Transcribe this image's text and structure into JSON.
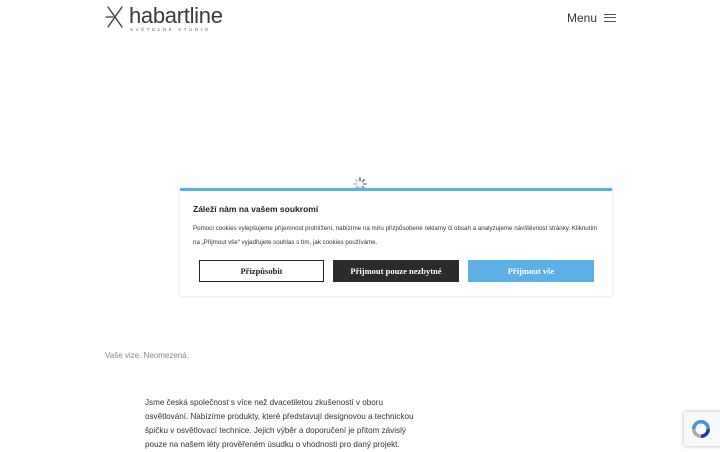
{
  "header": {
    "logo": {
      "name": "habartline",
      "tagline": "SVĚTELNÉ STUDIO"
    },
    "menu_label": "Menu"
  },
  "cookie_banner": {
    "title": "Záleží nám na vašem soukromí",
    "text": "Pomocí cookies vylepšujeme příjemnost prohlížení, nabízíme na míru přizpůsobené reklamy či obsah a analyzujeme návštěvnost stránky. Kliknutím na „Přijmout vše“ vyjadřujete souhlas s tím, jak cookies používáme.",
    "buttons": {
      "customize": "Přizpůsobit",
      "necessary_only": "Přijmout pouze nezbytné",
      "accept_all": "Přijmout vše"
    },
    "accent_color": "#5db0e5"
  },
  "main": {
    "tagline": "Vaše vize. Neomezená.",
    "about": "Jsme česká společnost s více než dvacetiletou zkušeností v oboru osvětlování. Nabízíme produkty, které představují designovou a technickou špičku v osvětlovací technice. Jejich výběr a doporučení je přitom závislý pouze na našem léty prověřeném úsudku o vhodnosti pro daný projekt."
  },
  "icons": {
    "logo_mark": "star-burst-logo",
    "menu": "hamburger-icon",
    "loading": "spinner-icon",
    "recaptcha": "recaptcha-icon"
  }
}
